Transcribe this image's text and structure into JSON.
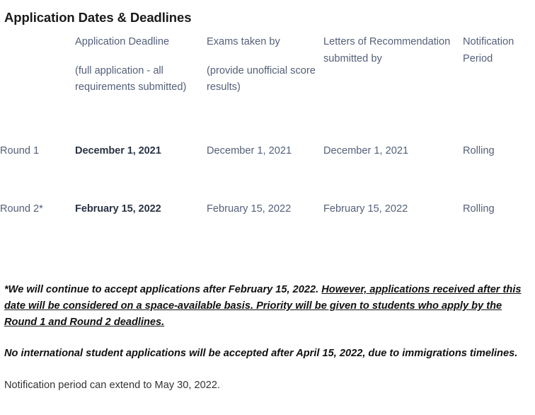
{
  "page": {
    "title": "Application Dates & Deadlines"
  },
  "table": {
    "columns": [
      {
        "main": "",
        "sub": ""
      },
      {
        "main": "Application Deadline",
        "sub": "(full application - all requirements submitted)"
      },
      {
        "main": "Exams taken by",
        "sub": "(provide unofficial score results)"
      },
      {
        "main": "Letters of Recommendation submitted by",
        "sub": ""
      },
      {
        "main": "Notification Period",
        "sub": ""
      }
    ],
    "rows": [
      {
        "round": "Round 1",
        "application_deadline": "December 1, 2021",
        "exams_taken_by": "December 1, 2021",
        "letters_submitted_by": "December 1, 2021",
        "notification_period": "Rolling"
      },
      {
        "round": "Round 2*",
        "application_deadline": "February 15, 2022",
        "exams_taken_by": "February 15, 2022",
        "letters_submitted_by": "February 15, 2022",
        "notification_period": "Rolling"
      }
    ]
  },
  "notes": {
    "note1_plain": "*We will continue to accept applications after February 15, 2022. ",
    "note1_underlined": "However, applications received after this date will be considered on a space-available basis. Priority will be given to students who apply by the Round 1 and Round 2 deadlines.",
    "note2": "No international student applications will be accepted  after April 15, 2022, due to immigrations timelines.",
    "note3": "Notification period can extend to May 30, 2022."
  },
  "colors": {
    "title": "#1a1a1a",
    "header_text": "#54607a",
    "body_text": "#54607a",
    "emphasis_text": "#2b3445",
    "note_text": "#111111",
    "background": "#ffffff"
  }
}
